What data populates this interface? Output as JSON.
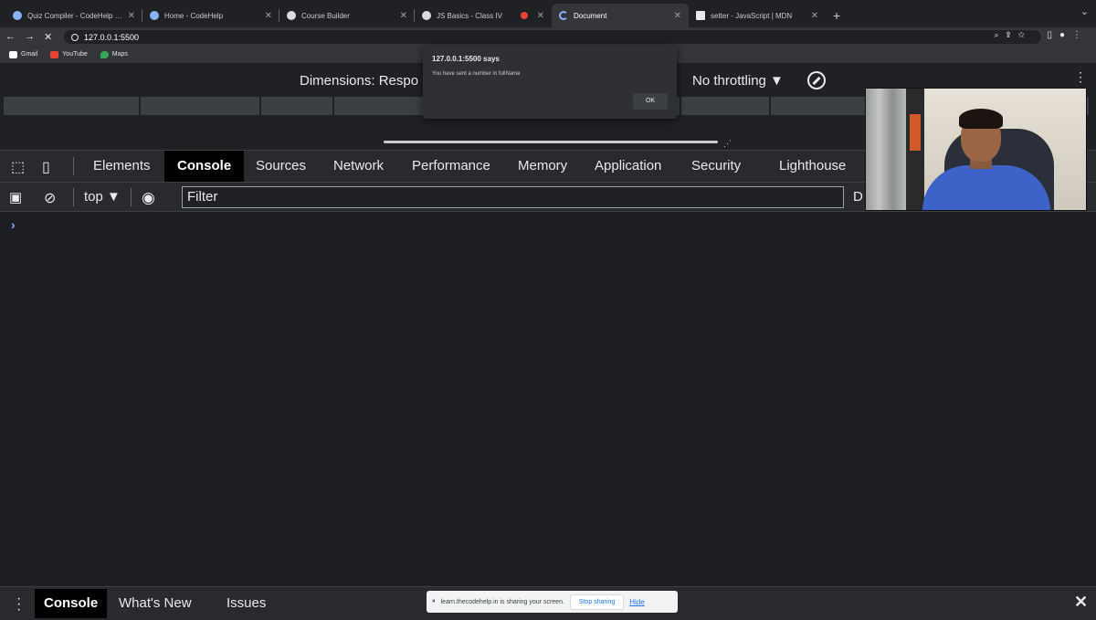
{
  "tabs": [
    {
      "title": "Quiz Compiler - CodeHelp Le",
      "active": false
    },
    {
      "title": "Home - CodeHelp",
      "active": false
    },
    {
      "title": "Course Builder",
      "active": false
    },
    {
      "title": "JS Basics - Class IV",
      "active": false
    },
    {
      "title": "Document",
      "active": true
    },
    {
      "title": "setter - JavaScript | MDN",
      "active": false
    }
  ],
  "address": {
    "url": "127.0.0.1:5500"
  },
  "bookmarks": [
    {
      "label": "Gmail",
      "color": "#ffffff"
    },
    {
      "label": "YouTube",
      "color": "#ea4335"
    },
    {
      "label": "Maps",
      "color": "#34a853"
    }
  ],
  "device_toolbar": {
    "dimensions": "Dimensions: Respo",
    "throttling": "No throttling ▼"
  },
  "alert": {
    "origin": "127.0.0.1:5500 says",
    "message": "You have sent a number in fullName",
    "ok_label": "OK"
  },
  "devtools": {
    "tabs": [
      {
        "label": "Elements",
        "active": false
      },
      {
        "label": "Console",
        "active": true
      },
      {
        "label": "Sources",
        "active": false
      },
      {
        "label": "Network",
        "active": false
      },
      {
        "label": "Performance",
        "active": false
      },
      {
        "label": "Memory",
        "active": false
      },
      {
        "label": "Application",
        "active": false
      },
      {
        "label": "Security",
        "active": false
      },
      {
        "label": "Lighthouse",
        "active": false
      }
    ],
    "context": "top ▼",
    "filter_placeholder": "Filter",
    "levels_truncated": "D",
    "prompt": "›"
  },
  "drawer": {
    "tabs": [
      {
        "label": "Console",
        "active": true
      },
      {
        "label": "What's New",
        "active": false
      },
      {
        "label": "Issues",
        "active": false
      }
    ]
  },
  "sharing": {
    "message": "learn.thecodehelp.in is sharing your screen.",
    "stop_label": "Stop sharing",
    "hide_label": "Hide"
  }
}
